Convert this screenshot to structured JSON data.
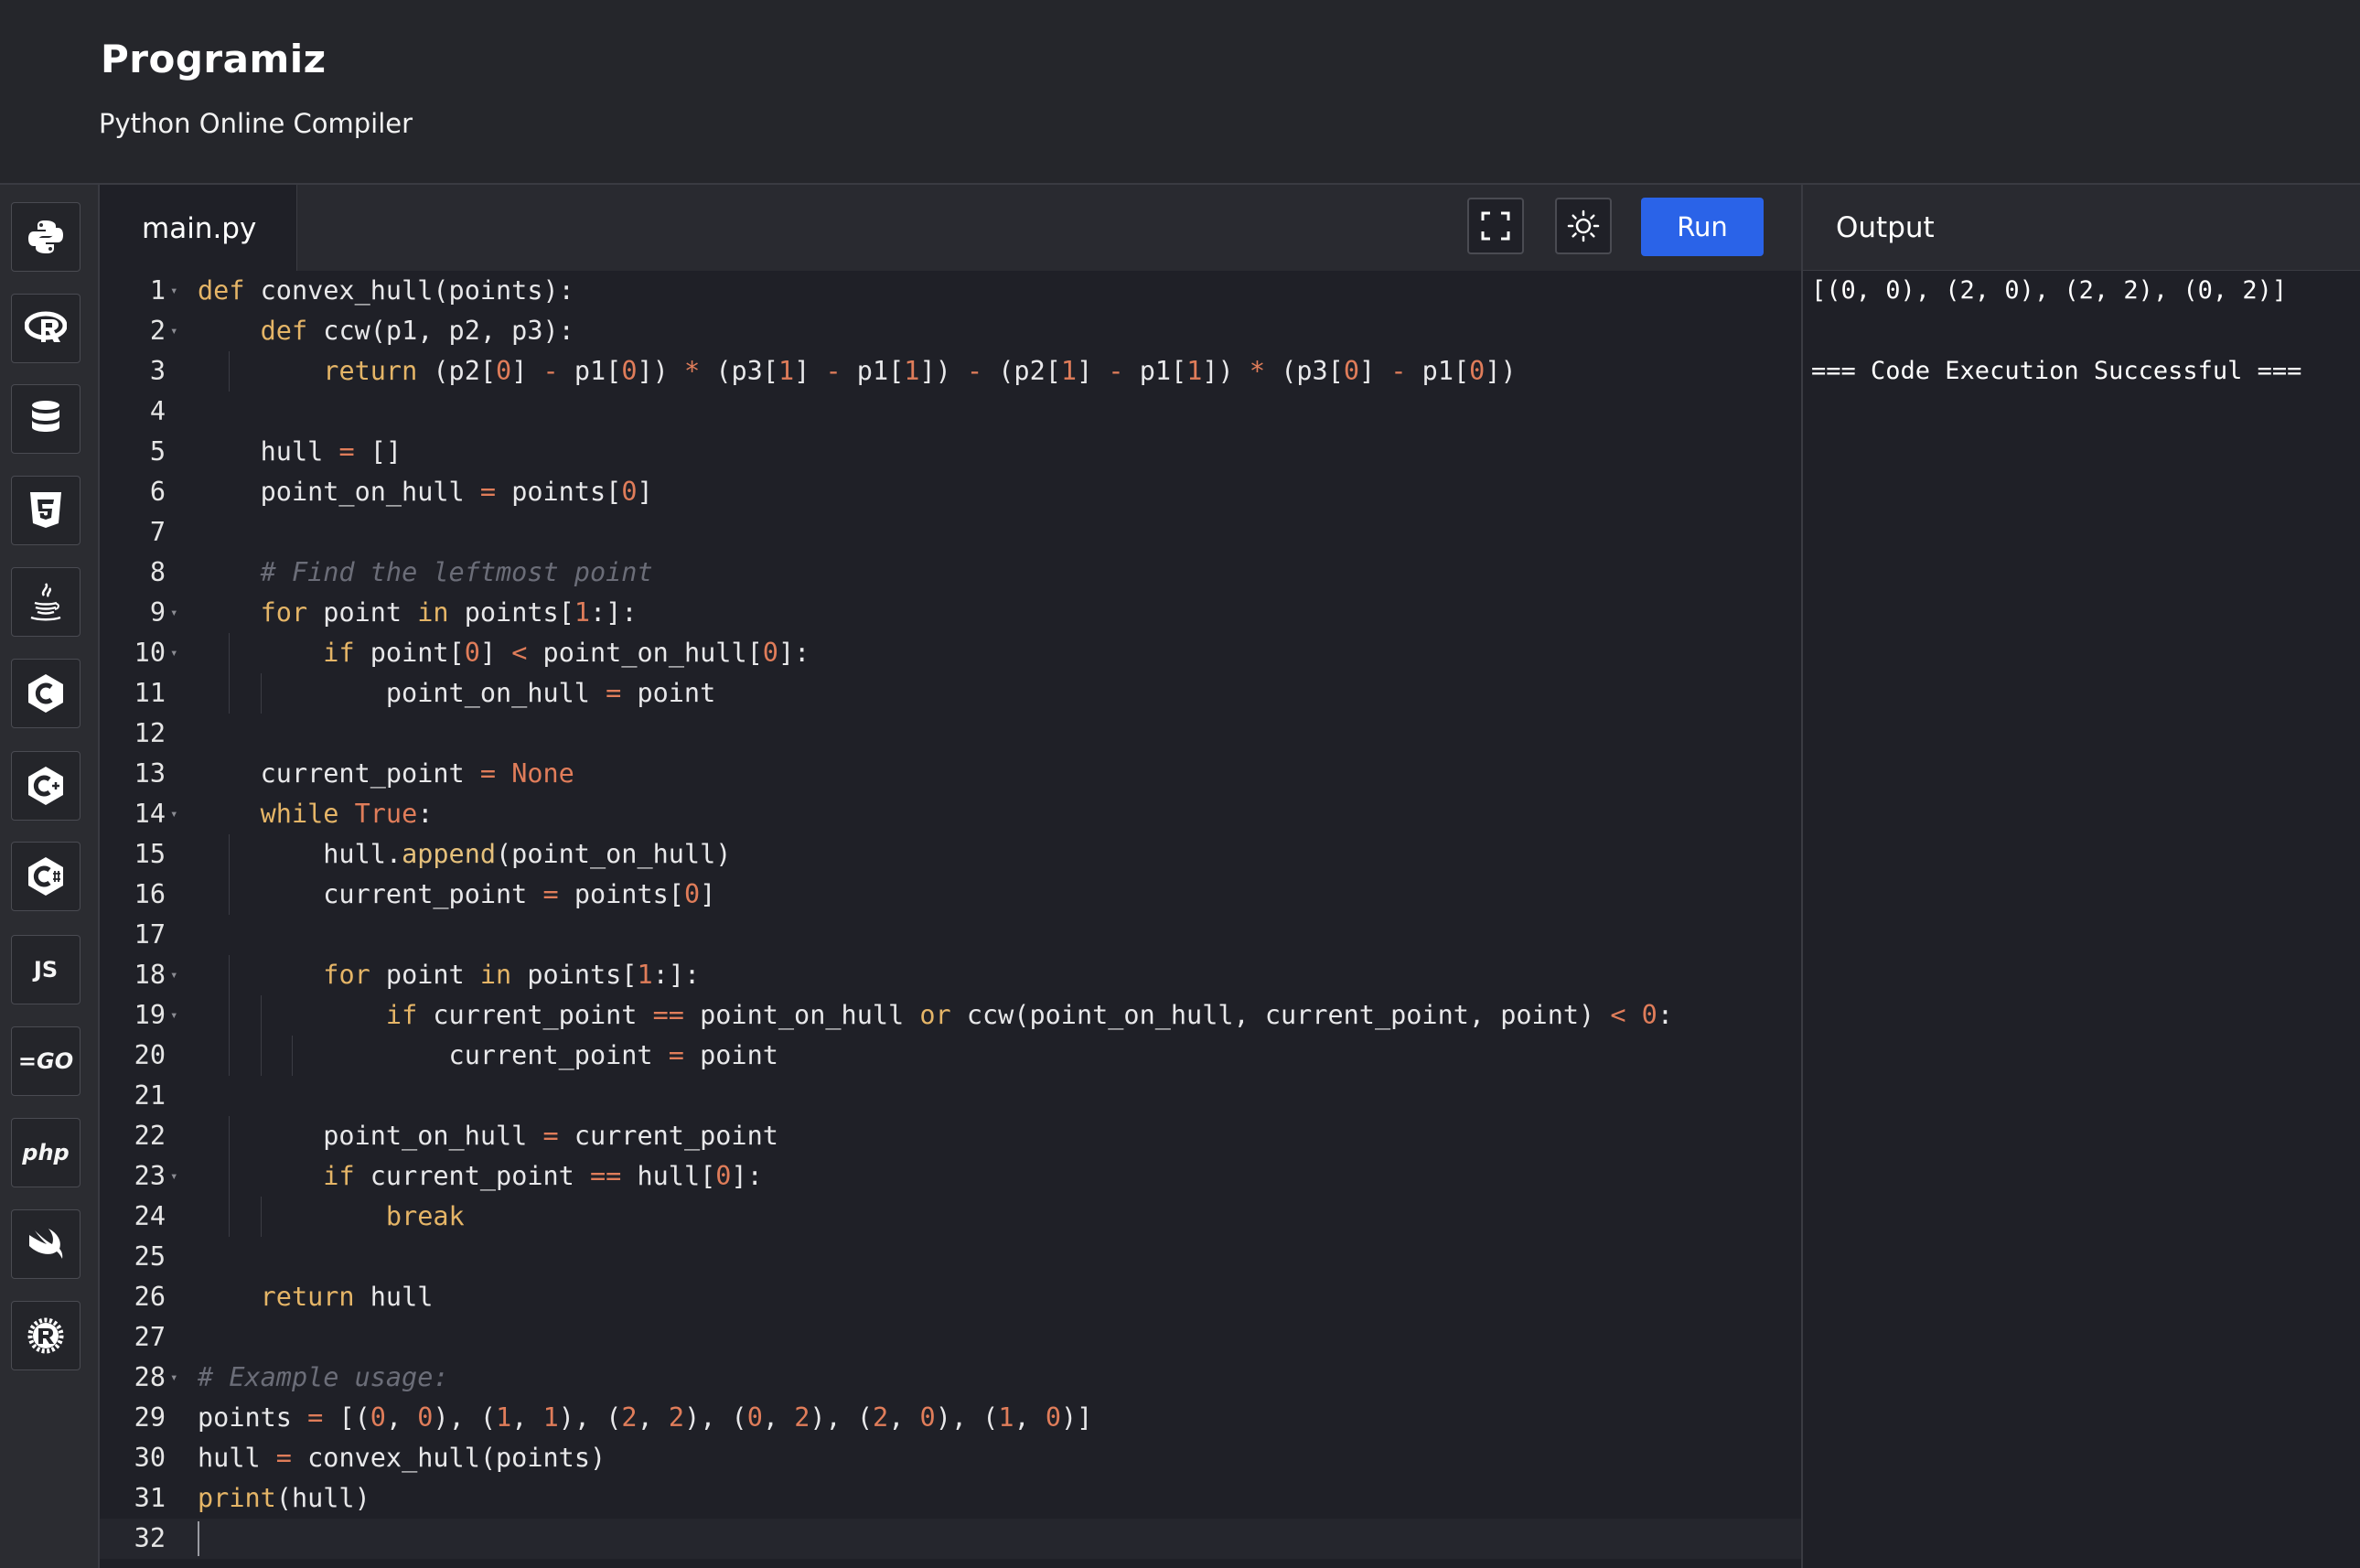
{
  "brand": {
    "logo": "Programiz",
    "subtitle": "Python Online Compiler"
  },
  "sidebar": {
    "items": [
      {
        "name": "python",
        "icon": "python-icon",
        "label": ""
      },
      {
        "name": "r",
        "icon": "r-icon",
        "label": ""
      },
      {
        "name": "sql",
        "icon": "database-icon",
        "label": ""
      },
      {
        "name": "html",
        "icon": "html5-icon",
        "label": ""
      },
      {
        "name": "java",
        "icon": "java-icon",
        "label": ""
      },
      {
        "name": "c",
        "icon": "c-icon",
        "label": ""
      },
      {
        "name": "cpp",
        "icon": "cpp-icon",
        "label": ""
      },
      {
        "name": "csharp",
        "icon": "csharp-icon",
        "label": ""
      },
      {
        "name": "javascript",
        "icon": "js-icon",
        "label": "JS"
      },
      {
        "name": "go",
        "icon": "go-icon",
        "label": "GO"
      },
      {
        "name": "php",
        "icon": "php-icon",
        "label": "php"
      },
      {
        "name": "swift",
        "icon": "swift-icon",
        "label": ""
      },
      {
        "name": "rust",
        "icon": "rust-icon",
        "label": ""
      }
    ]
  },
  "editor": {
    "tab_label": "main.py",
    "run_label": "Run",
    "fullscreen_icon": "fullscreen-icon",
    "theme_icon": "sun-icon",
    "lines": [
      "def convex_hull(points):",
      "    def ccw(p1, p2, p3):",
      "        return (p2[0] - p1[0]) * (p3[1] - p1[1]) - (p2[1] - p1[1]) * (p3[0] - p1[0])",
      "",
      "    hull = []",
      "    point_on_hull = points[0]",
      "",
      "    # Find the leftmost point",
      "    for point in points[1:]:",
      "        if point[0] < point_on_hull[0]:",
      "            point_on_hull = point",
      "",
      "    current_point = None",
      "    while True:",
      "        hull.append(point_on_hull)",
      "        current_point = points[0]",
      "",
      "        for point in points[1:]:",
      "            if current_point == point_on_hull or ccw(point_on_hull, current_point, point) < 0:",
      "                current_point = point",
      "",
      "        point_on_hull = current_point",
      "        if current_point == hull[0]:",
      "            break",
      "",
      "    return hull",
      "",
      "# Example usage:",
      "points = [(0, 0), (1, 1), (2, 2), (0, 2), (2, 0), (1, 0)]",
      "hull = convex_hull(points)",
      "print(hull)",
      ""
    ],
    "fold_lines": [
      1,
      2,
      9,
      10,
      14,
      18,
      19,
      23,
      28
    ]
  },
  "output": {
    "title": "Output",
    "lines": [
      "[(0, 0), (2, 0), (2, 2), (0, 2)]",
      "",
      "=== Code Execution Successful ==="
    ]
  },
  "colors": {
    "run_button": "#2a63e8",
    "keyword": "#e5b567",
    "number": "#e07d5a",
    "comment": "#6b6d78",
    "background": "#1f2027"
  }
}
